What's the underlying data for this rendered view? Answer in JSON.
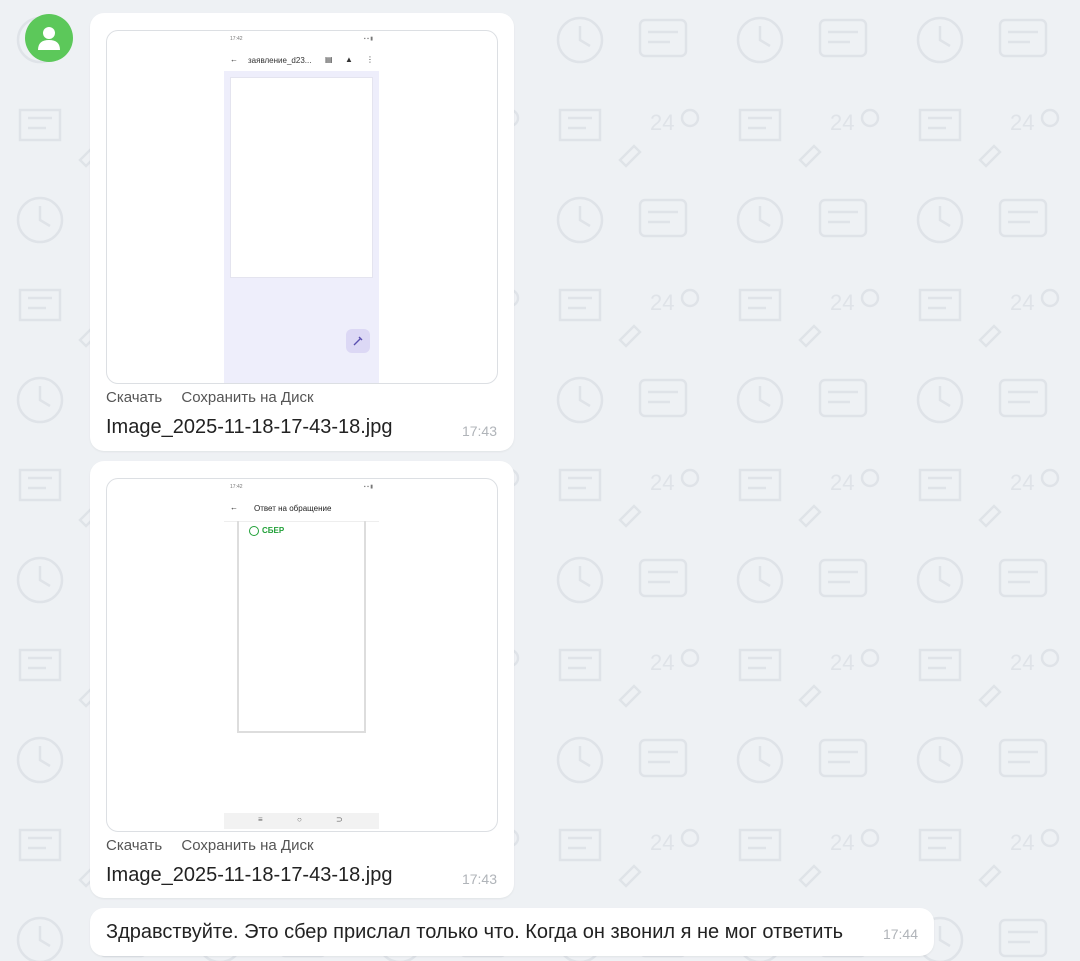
{
  "messages": [
    {
      "type": "image",
      "actions": {
        "download": "Скачать",
        "save_disk": "Сохранить на Диск"
      },
      "filename": "Image_2025-11-18-17-43-18.jpg",
      "time": "17:43",
      "preview": {
        "status_time": "17:42",
        "title": "заявление_d23...",
        "fab_icon": "edit-sparkle-icon"
      }
    },
    {
      "type": "image",
      "actions": {
        "download": "Скачать",
        "save_disk": "Сохранить на Диск"
      },
      "filename": "Image_2025-11-18-17-43-18.jpg",
      "time": "17:43",
      "preview": {
        "status_time": "17:42",
        "title": "Ответ на обращение",
        "brand": "СБЕР"
      }
    },
    {
      "type": "text",
      "text": "Здравствуйте. Это сбер прислал только что. Когда он звонил я не мог ответить",
      "time": "17:44"
    }
  ],
  "colors": {
    "avatar": "#5cc85a",
    "background": "#eef1f4",
    "sber_green": "#21a038",
    "preview_lavender": "#eeeefb"
  }
}
